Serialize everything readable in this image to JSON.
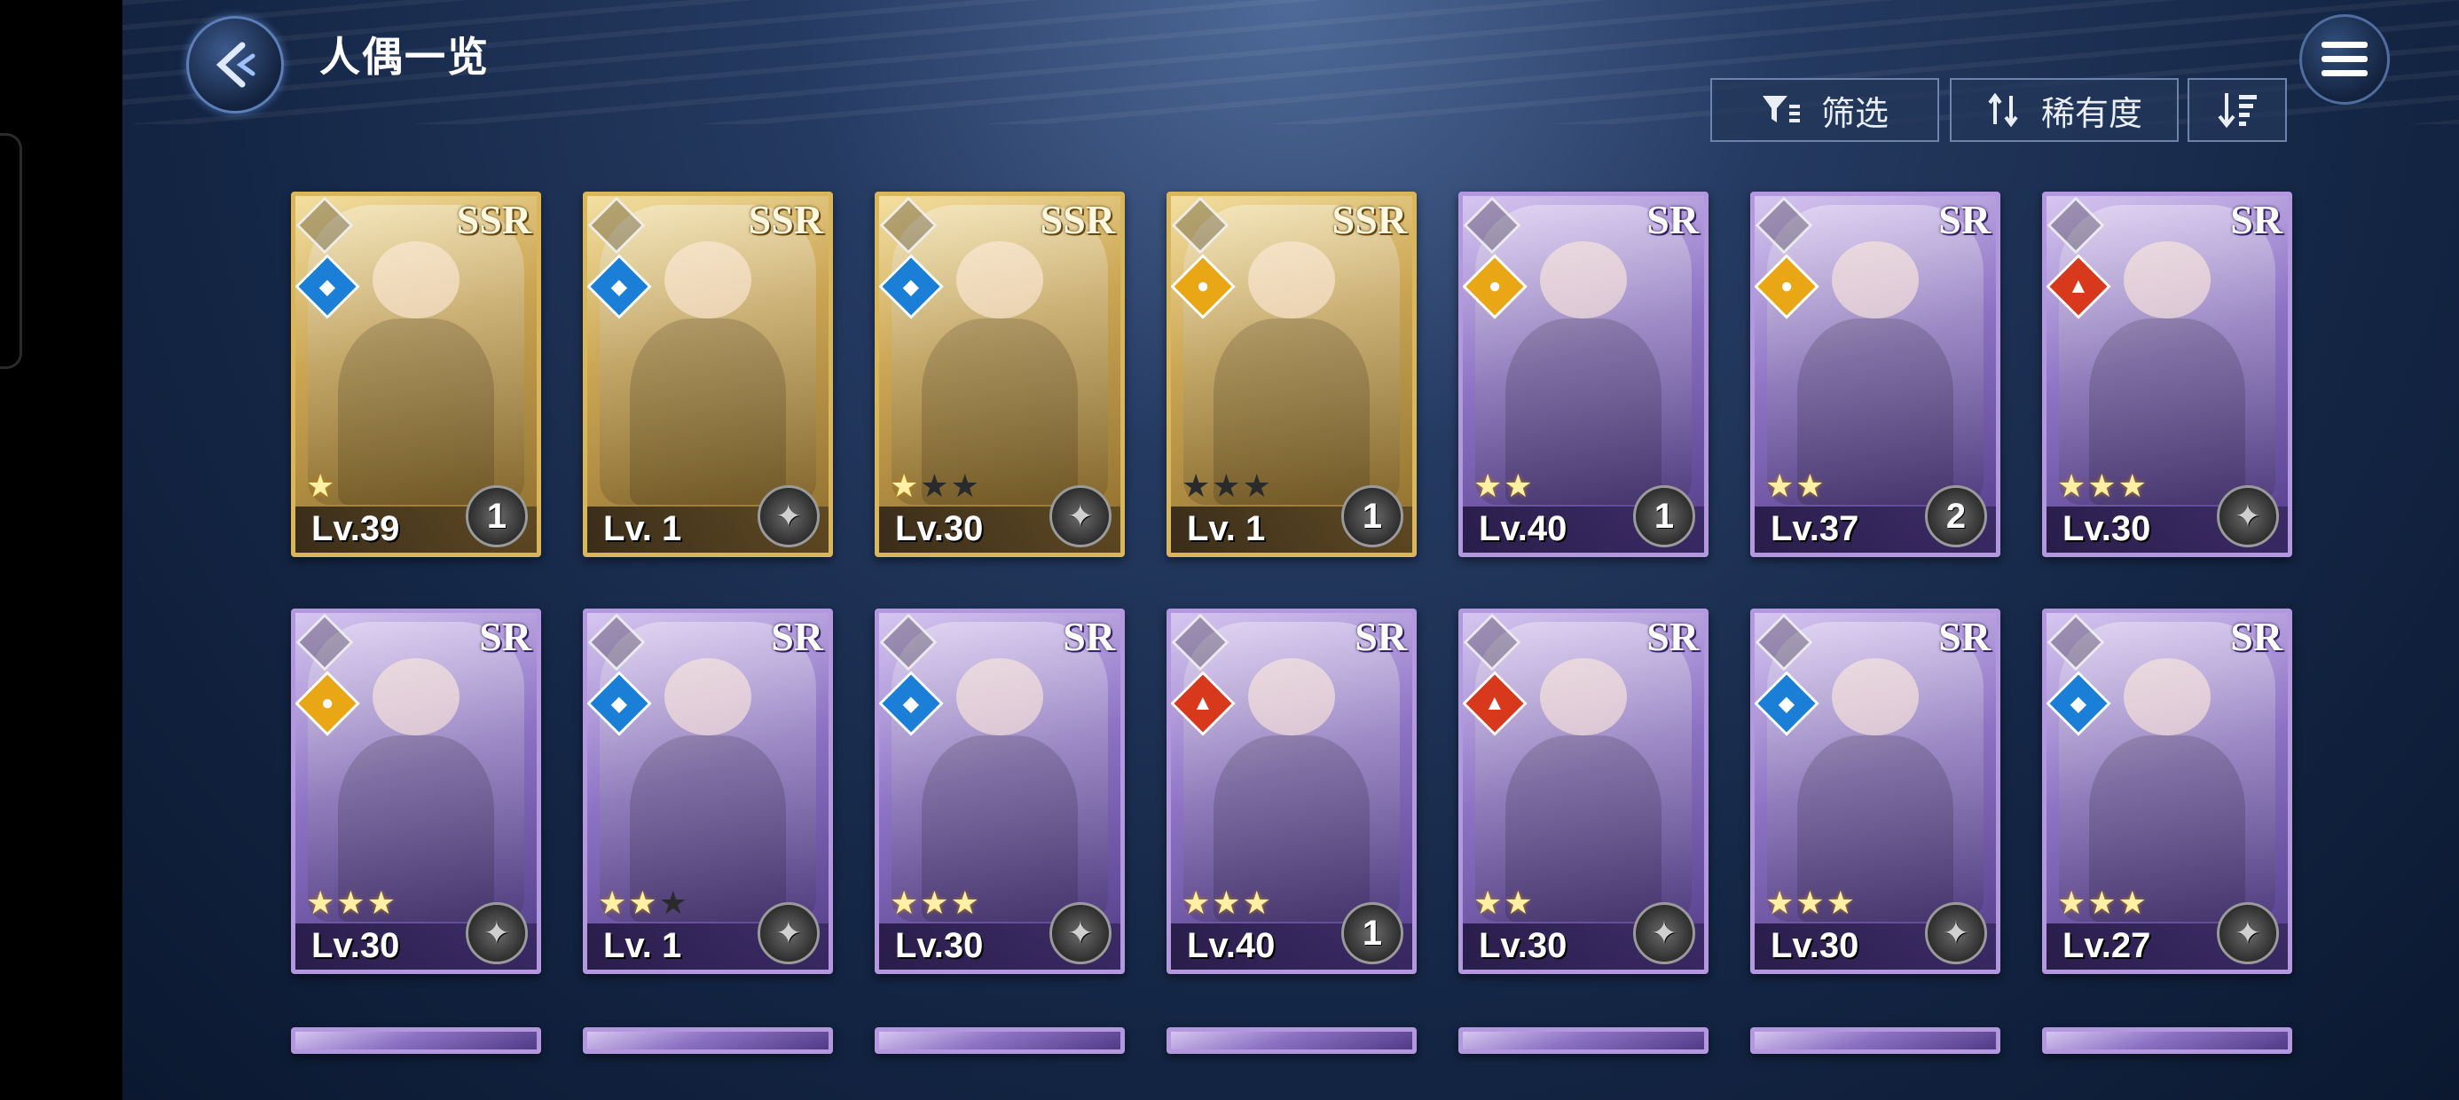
{
  "header": {
    "title": "人偶一览",
    "filter_label": "筛选",
    "sort_label": "稀有度"
  },
  "icons": {
    "back": "back-arrow-icon",
    "menu": "hamburger-menu-icon",
    "filter": "filter-icon",
    "sort": "sort-swap-icon",
    "order": "sort-order-icon"
  },
  "colors": {
    "ssr_frame": "#d9b65a",
    "sr_frame": "#b398e0",
    "water": "#1b7fd8",
    "fire": "#d8381b",
    "light": "#e9a615"
  },
  "cards_row1": [
    {
      "rarity": "SSR",
      "element": "water",
      "stars": 1,
      "max_stars": 1,
      "level": "Lv.39",
      "bond": "1"
    },
    {
      "rarity": "SSR",
      "element": "water",
      "stars": 0,
      "max_stars": 0,
      "level": "Lv. 1",
      "bond": ""
    },
    {
      "rarity": "SSR",
      "element": "water",
      "stars": 1,
      "max_stars": 3,
      "level": "Lv.30",
      "bond": ""
    },
    {
      "rarity": "SSR",
      "element": "light",
      "stars": 0,
      "max_stars": 3,
      "level": "Lv. 1",
      "bond": "1"
    },
    {
      "rarity": "SR",
      "element": "light",
      "stars": 2,
      "max_stars": 2,
      "level": "Lv.40",
      "bond": "1"
    },
    {
      "rarity": "SR",
      "element": "light",
      "stars": 2,
      "max_stars": 2,
      "level": "Lv.37",
      "bond": "2"
    },
    {
      "rarity": "SR",
      "element": "fire",
      "stars": 3,
      "max_stars": 3,
      "level": "Lv.30",
      "bond": ""
    }
  ],
  "cards_row2": [
    {
      "rarity": "SR",
      "element": "light",
      "stars": 3,
      "max_stars": 3,
      "level": "Lv.30",
      "bond": ""
    },
    {
      "rarity": "SR",
      "element": "water",
      "stars": 2,
      "max_stars": 3,
      "level": "Lv. 1",
      "bond": ""
    },
    {
      "rarity": "SR",
      "element": "water",
      "stars": 3,
      "max_stars": 3,
      "level": "Lv.30",
      "bond": ""
    },
    {
      "rarity": "SR",
      "element": "fire",
      "stars": 3,
      "max_stars": 3,
      "level": "Lv.40",
      "bond": "1"
    },
    {
      "rarity": "SR",
      "element": "fire",
      "stars": 2,
      "max_stars": 2,
      "level": "Lv.30",
      "bond": ""
    },
    {
      "rarity": "SR",
      "element": "water",
      "stars": 3,
      "max_stars": 3,
      "level": "Lv.30",
      "bond": ""
    },
    {
      "rarity": "SR",
      "element": "water",
      "stars": 3,
      "max_stars": 3,
      "level": "Lv.27",
      "bond": ""
    }
  ]
}
